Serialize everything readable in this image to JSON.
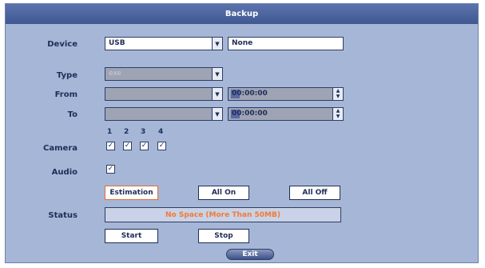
{
  "title": "Backup",
  "device": {
    "label": "Device",
    "value": "USB",
    "info": "None"
  },
  "type": {
    "label": "Type",
    "value": "exe"
  },
  "from": {
    "label": "From",
    "date": "",
    "time": "00:00:00"
  },
  "to": {
    "label": "To",
    "date": "",
    "time": "00:00:00"
  },
  "camera": {
    "label": "Camera",
    "numbers": [
      "1",
      "2",
      "3",
      "4"
    ],
    "checked": [
      true,
      true,
      true,
      true
    ]
  },
  "audio": {
    "label": "Audio",
    "checked": true
  },
  "buttons": {
    "estimation": "Estimation",
    "all_on": "All On",
    "all_off": "All Off",
    "start": "Start",
    "stop": "Stop",
    "exit": "Exit"
  },
  "status": {
    "label": "Status",
    "text": "No Space (More Than 50MB)"
  },
  "icons": {
    "dropdown": "chevron-down-icon",
    "spin": "spin-updown-icon",
    "check": "checkbox-checked-icon"
  },
  "colors": {
    "title_bar": "#4a63a0",
    "panel": "#a6b6d6",
    "status_text": "#f07a38",
    "focus_border": "#e46c2e"
  }
}
